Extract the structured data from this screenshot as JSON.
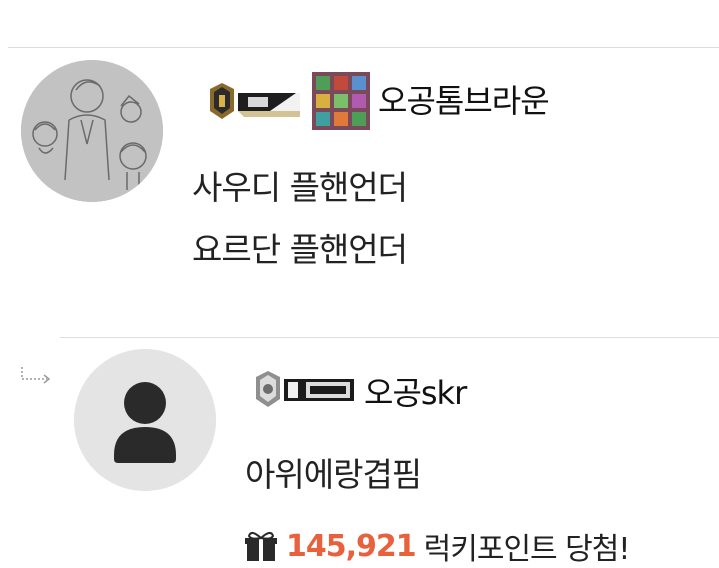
{
  "comments": [
    {
      "nickname": "오공톰브라운",
      "lines": [
        "사우디 플핸언더",
        "요르단 플핸언더"
      ],
      "rank_badge_icon": "rank-medal-badge",
      "level_badge_icon": "puzzle-badge"
    },
    {
      "nickname": "오공skr",
      "lines": [
        "아위에랑겹핌"
      ],
      "rank_badge_icon": "rank-medal-badge",
      "is_reply": true
    }
  ],
  "lucky_point": {
    "amount": "145,921",
    "label": "럭키포인트 당첨!",
    "icon": "gift-icon",
    "amount_color": "#e8603c"
  }
}
